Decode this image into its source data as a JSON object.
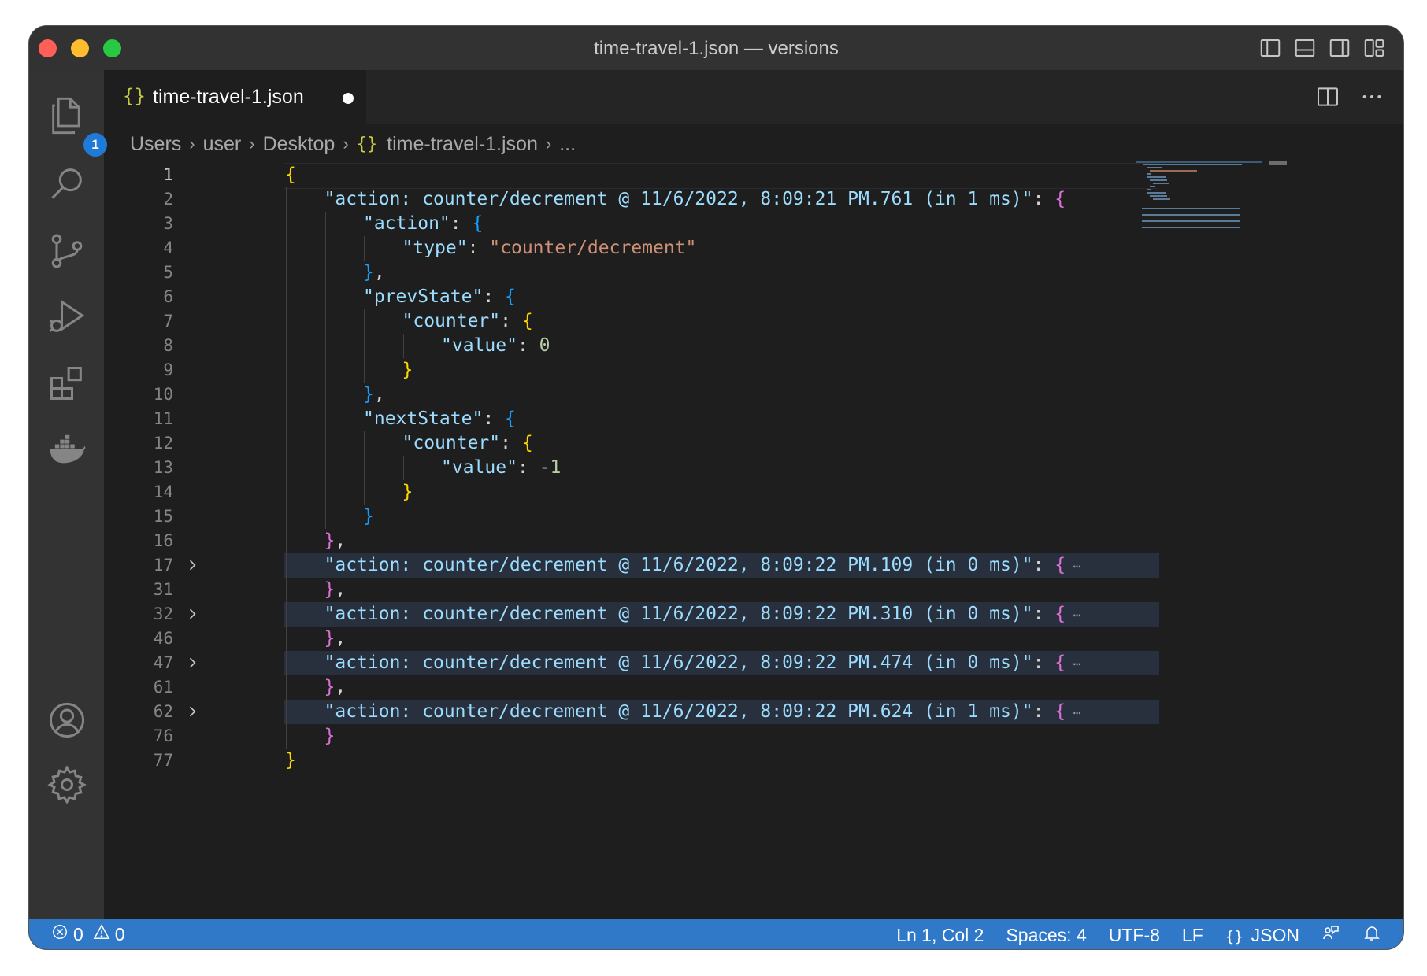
{
  "window": {
    "title": "time-travel-1.json — versions"
  },
  "activity_bar": {
    "icons": [
      "explorer-icon",
      "search-icon",
      "source-control-icon",
      "run-debug-icon",
      "extensions-icon",
      "docker-icon",
      "account-icon",
      "settings-gear-icon"
    ],
    "explorer_badge": "1"
  },
  "tab": {
    "icon": "{}",
    "label": "time-travel-1.json",
    "dirty": true
  },
  "breadcrumb": {
    "items": [
      "Users",
      "user",
      "Desktop",
      "time-travel-1.json",
      "..."
    ],
    "file_icon": "{}"
  },
  "editor": {
    "lines": [
      {
        "n": "1",
        "indent": 0,
        "text": "{"
      },
      {
        "n": "2",
        "indent": 1,
        "text": "\"action: counter/decrement @ 11/6/2022, 8:09:21 PM.761 (in 1 ms)\": {"
      },
      {
        "n": "3",
        "indent": 2,
        "text": "\"action\": {"
      },
      {
        "n": "4",
        "indent": 3,
        "text": "\"type\": \"counter/decrement\""
      },
      {
        "n": "5",
        "indent": 2,
        "text": "},"
      },
      {
        "n": "6",
        "indent": 2,
        "text": "\"prevState\": {"
      },
      {
        "n": "7",
        "indent": 3,
        "text": "\"counter\": {"
      },
      {
        "n": "8",
        "indent": 4,
        "text": "\"value\": 0"
      },
      {
        "n": "9",
        "indent": 3,
        "text": "}"
      },
      {
        "n": "10",
        "indent": 2,
        "text": "},"
      },
      {
        "n": "11",
        "indent": 2,
        "text": "\"nextState\": {"
      },
      {
        "n": "12",
        "indent": 3,
        "text": "\"counter\": {"
      },
      {
        "n": "13",
        "indent": 4,
        "text": "\"value\": -1"
      },
      {
        "n": "14",
        "indent": 3,
        "text": "}"
      },
      {
        "n": "15",
        "indent": 2,
        "text": "}"
      },
      {
        "n": "16",
        "indent": 1,
        "text": "},"
      },
      {
        "n": "17",
        "indent": 1,
        "text": "\"action: counter/decrement @ 11/6/2022, 8:09:22 PM.109 (in 0 ms)\": {",
        "folded": true
      },
      {
        "n": "31",
        "indent": 1,
        "text": "},"
      },
      {
        "n": "32",
        "indent": 1,
        "text": "\"action: counter/decrement @ 11/6/2022, 8:09:22 PM.310 (in 0 ms)\": {",
        "folded": true
      },
      {
        "n": "46",
        "indent": 1,
        "text": "},"
      },
      {
        "n": "47",
        "indent": 1,
        "text": "\"action: counter/decrement @ 11/6/2022, 8:09:22 PM.474 (in 0 ms)\": {",
        "folded": true
      },
      {
        "n": "61",
        "indent": 1,
        "text": "},"
      },
      {
        "n": "62",
        "indent": 1,
        "text": "\"action: counter/decrement @ 11/6/2022, 8:09:22 PM.624 (in 1 ms)\": {",
        "folded": true
      },
      {
        "n": "76",
        "indent": 1,
        "text": "}"
      },
      {
        "n": "77",
        "indent": 0,
        "text": "}"
      }
    ],
    "fold_ellipsis": "⋯",
    "active_line": "1"
  },
  "status_bar": {
    "errors": "0",
    "warnings": "0",
    "cursor": "Ln 1, Col 2",
    "indent": "Spaces: 4",
    "encoding": "UTF-8",
    "eol": "LF",
    "language_icon": "{}",
    "language": "JSON"
  },
  "colors": {
    "status_bar": "#3079c9",
    "key": "#9cdcfe",
    "string": "#ce9178",
    "number": "#b5cea8",
    "bracket_1": "#ffd700",
    "bracket_2": "#da70d6",
    "bracket_3": "#179fff"
  }
}
